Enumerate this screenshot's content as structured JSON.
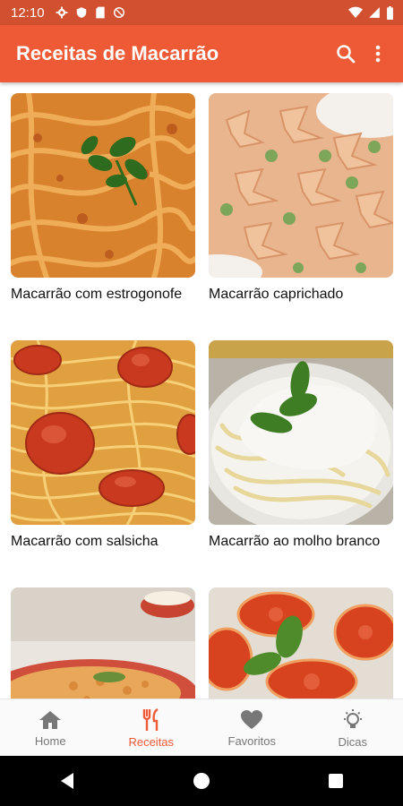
{
  "status_bar": {
    "time": "12:10",
    "icons": [
      "gear-icon",
      "shield-icon",
      "sd-card-icon",
      "no-sim-icon"
    ],
    "right_icons": [
      "wifi-icon",
      "signal-icon",
      "battery-icon"
    ]
  },
  "app_bar": {
    "title": "Receitas de Macarrão",
    "actions": [
      "search-icon",
      "more-vert-icon"
    ]
  },
  "recipes": [
    {
      "title": "Macarrão com estrogonofe"
    },
    {
      "title": "Macarrão caprichado"
    },
    {
      "title": "Macarrão com salsicha"
    },
    {
      "title": "Macarrão ao molho branco"
    },
    {
      "title": ""
    },
    {
      "title": ""
    }
  ],
  "bottom_nav": {
    "items": [
      {
        "label": "Home",
        "icon": "home-icon",
        "active": false
      },
      {
        "label": "Receitas",
        "icon": "fork-knife-icon",
        "active": true
      },
      {
        "label": "Favoritos",
        "icon": "heart-icon",
        "active": false
      },
      {
        "label": "Dicas",
        "icon": "lightbulb-icon",
        "active": false
      }
    ]
  },
  "colors": {
    "primary": "#ef5a36",
    "primary_dark": "#d1502f",
    "nav_inactive": "#777777"
  }
}
